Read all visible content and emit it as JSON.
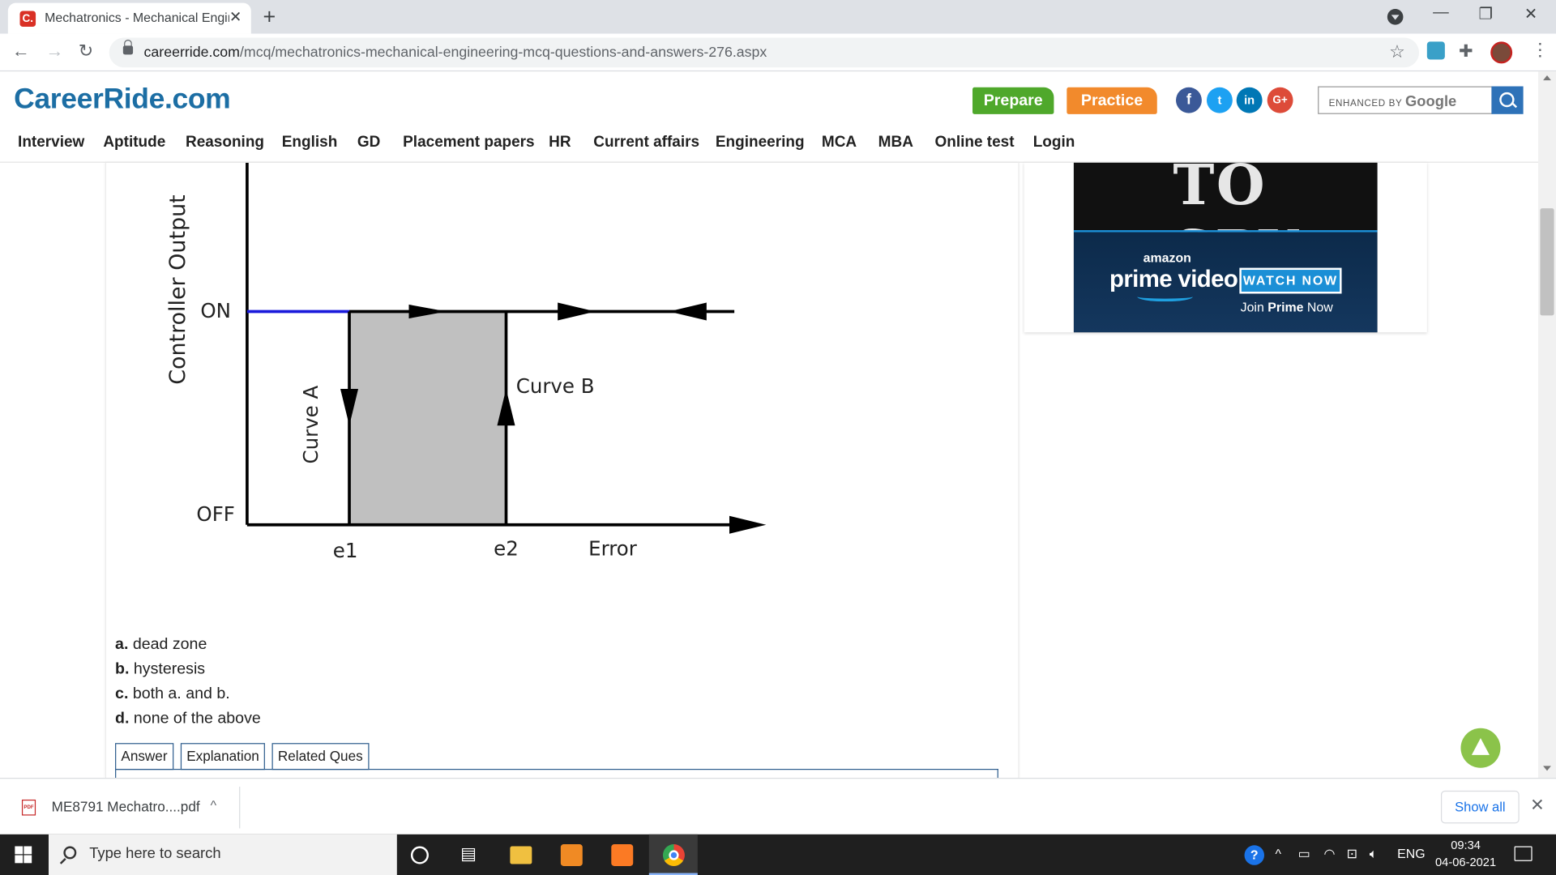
{
  "browser": {
    "tab_title": "Mechatronics - Mechanical Engin",
    "tab_favicon": "C.",
    "url_host": "careerride.com",
    "url_path": "/mcq/mechatronics-mechanical-engineering-mcq-questions-and-answers-276.aspx"
  },
  "site": {
    "logo": "CareerRide.com",
    "prepare_label": "Prepare",
    "practice_label": "Practice",
    "social": [
      "f",
      "t",
      "in",
      "G+"
    ],
    "search_placeholder_prefix": "ENHANCED BY",
    "search_placeholder_brand": "Google",
    "menu": [
      "Interview",
      "Aptitude",
      "Reasoning",
      "English",
      "GD",
      "Placement papers",
      "HR",
      "Current affairs",
      "Engineering",
      "MCA",
      "MBA",
      "Online test",
      "Login"
    ]
  },
  "diagram": {
    "y_axis_label": "Controller Output",
    "on_label": "ON",
    "off_label": "OFF",
    "e1_label": "e1",
    "e2_label": "e2",
    "x_axis_label": "Error",
    "curve_a": "Curve A",
    "curve_b": "Curve B"
  },
  "question": {
    "options": [
      {
        "letter": "a.",
        "text": "dead zone"
      },
      {
        "letter": "b.",
        "text": "hysteresis"
      },
      {
        "letter": "c.",
        "text": "both a. and b."
      },
      {
        "letter": "d.",
        "text": "none of the above"
      }
    ],
    "tabs": [
      "Answer",
      "Explanation",
      "Related Ques"
    ]
  },
  "ad": {
    "headline_fragment": "TO SPY",
    "brand_small": "amazon",
    "brand_big": "prime video",
    "cta": "WATCH NOW",
    "join_prefix": "Join ",
    "join_bold": "Prime",
    "join_suffix": " Now"
  },
  "downloads": {
    "file_name": "ME8791 Mechatro....pdf",
    "show_all": "Show all"
  },
  "taskbar": {
    "search_placeholder": "Type here to search",
    "lang": "ENG",
    "time": "09:34",
    "date": "04-06-2021"
  },
  "colors": {
    "brand_blue": "#1c6ea4",
    "prepare_green": "#4fa82b",
    "practice_orange": "#f28a2c",
    "hysteresis_fill": "#c0c0c0",
    "on_line_blue": "#1a1adb"
  }
}
